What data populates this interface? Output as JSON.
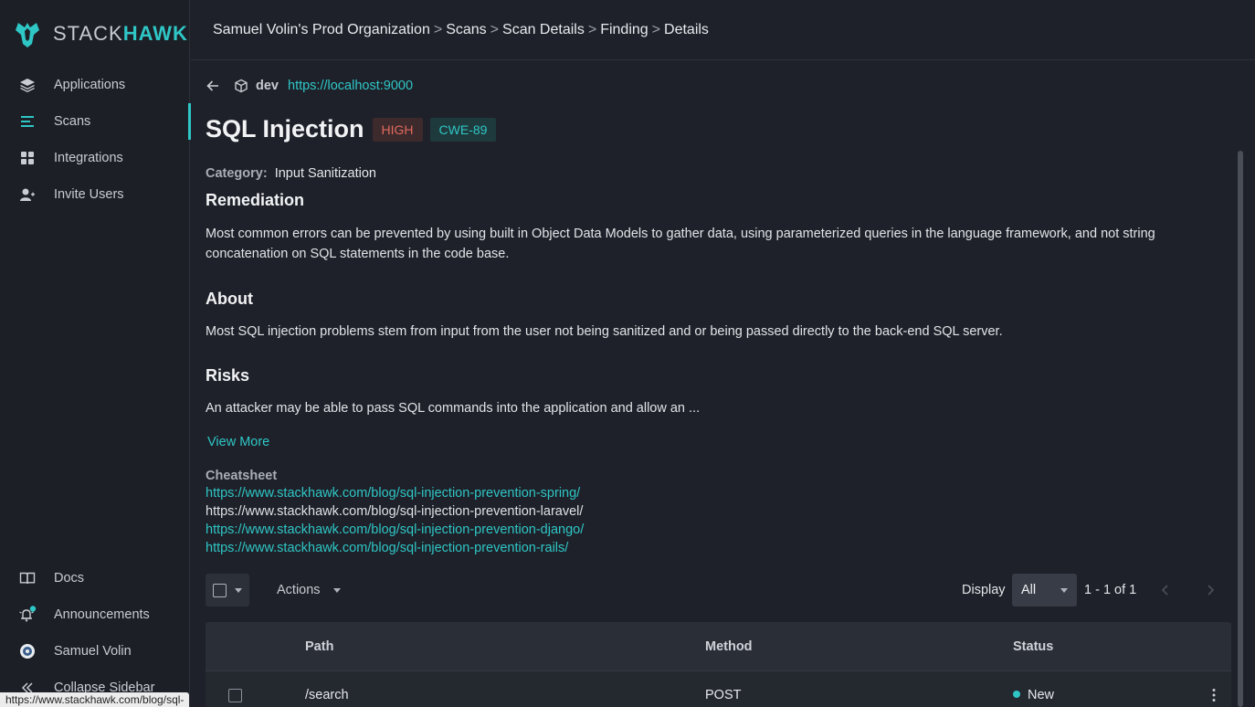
{
  "brand": {
    "logo_stack": "STACK",
    "logo_hawk": "HAWK"
  },
  "breadcrumb": {
    "items": [
      "Samuel Volin's Prod Organization",
      "Scans",
      "Scan Details",
      "Finding",
      "Details"
    ],
    "separator": ">"
  },
  "sidebar": {
    "nav": [
      {
        "label": "Applications",
        "icon": "layers-icon"
      },
      {
        "label": "Scans",
        "icon": "scans-icon",
        "active": true
      },
      {
        "label": "Integrations",
        "icon": "grid-icon"
      },
      {
        "label": "Invite Users",
        "icon": "user-plus-icon"
      }
    ],
    "bottom": [
      {
        "label": "Docs",
        "icon": "book-icon"
      },
      {
        "label": "Announcements",
        "icon": "bell-icon"
      },
      {
        "label": "Samuel Volin",
        "icon": "avatar"
      },
      {
        "label": "Collapse Sidebar",
        "icon": "collapse-icon"
      }
    ]
  },
  "finding": {
    "env": "dev",
    "url": "https://localhost:9000",
    "title": "SQL Injection",
    "severity": "HIGH",
    "cwe": "CWE-89",
    "category_label": "Category:",
    "category": "Input Sanitization",
    "remediation_heading": "Remediation",
    "remediation": "Most common errors can be prevented by using built in Object Data Models to gather data, using parameterized queries in the language framework, and not string concatenation on SQL statements in the code base.",
    "about_heading": "About",
    "about": "Most SQL injection problems stem from input from the user not being sanitized and or being passed directly to the back-end SQL server.",
    "risks_heading": "Risks",
    "risks": "An attacker may be able to pass SQL commands into the application and allow an ...",
    "view_more": "View More",
    "cheatsheet_label": "Cheatsheet",
    "cheatsheet": [
      "https://www.stackhawk.com/blog/sql-injection-prevention-spring/",
      "https://www.stackhawk.com/blog/sql-injection-prevention-laravel/",
      "https://www.stackhawk.com/blog/sql-injection-prevention-django/",
      "https://www.stackhawk.com/blog/sql-injection-prevention-rails/"
    ]
  },
  "toolbar": {
    "actions_label": "Actions",
    "display_label": "Display",
    "display_value": "All",
    "page_count": "1 - 1 of 1"
  },
  "table": {
    "columns": [
      "Path",
      "Method",
      "Status"
    ],
    "rows": [
      {
        "path": "/search",
        "method": "POST",
        "status": "New"
      }
    ]
  },
  "statusbar": {
    "url": "https://www.stackhawk.com/blog/sql-injection-prevention-laravel/"
  },
  "colors": {
    "accent": "#2fc6c6",
    "high": "#e06a5e",
    "background": "#1e2129"
  }
}
